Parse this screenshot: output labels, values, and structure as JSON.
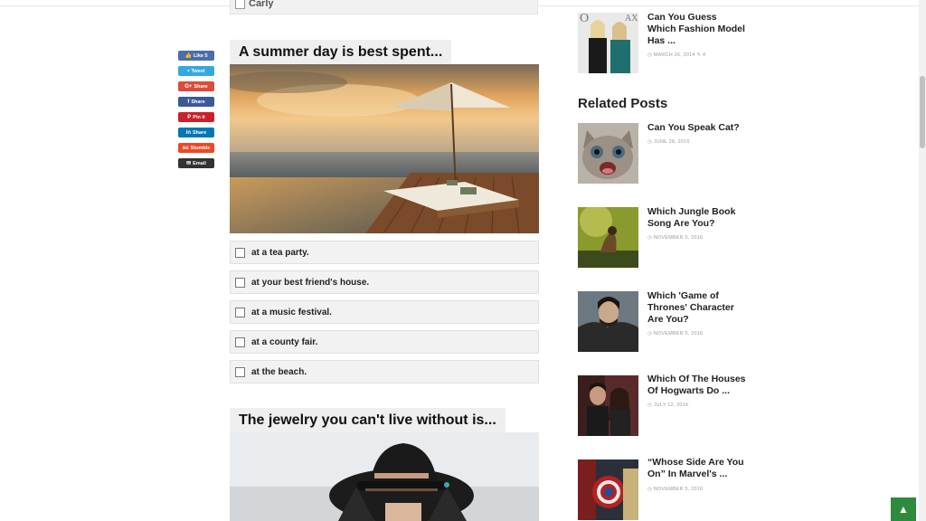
{
  "prev_answer": {
    "label": "Carly"
  },
  "share_buttons": [
    {
      "label": "Like 5",
      "icon": "thumbs-up-icon",
      "glyph": "👍",
      "color": "#4a6ea8"
    },
    {
      "label": "Tweet",
      "icon": "twitter-icon",
      "glyph": "•",
      "color": "#35a8e0"
    },
    {
      "label": "Share",
      "icon": "google-plus-icon",
      "glyph": "G+",
      "color": "#dd4b39"
    },
    {
      "label": "Share",
      "icon": "facebook-icon",
      "glyph": "f",
      "color": "#3b5998"
    },
    {
      "label": "Pin it",
      "icon": "pinterest-icon",
      "glyph": "P",
      "color": "#cb2027"
    },
    {
      "label": "Share",
      "icon": "linkedin-icon",
      "glyph": "in",
      "color": "#0077b5"
    },
    {
      "label": "Stumble",
      "icon": "stumbleupon-icon",
      "glyph": "su",
      "color": "#eb4924"
    },
    {
      "label": "Email",
      "icon": "email-icon",
      "glyph": "✉",
      "color": "#333333"
    }
  ],
  "question1": {
    "title": "A summer day is best spent...",
    "answers": [
      "at a tea party.",
      "at your best friend's house.",
      "at a music festival.",
      "at a county fair.",
      "at the beach."
    ]
  },
  "question2": {
    "title": "The jewelry you can't live without is..."
  },
  "sidebar": {
    "top_post": {
      "title": "Can You Guess Which Fashion Model Has ...",
      "date": "MARCH 26, 2014",
      "comments": "4"
    },
    "related_heading": "Related Posts",
    "related": [
      {
        "title": "Can You Speak Cat?",
        "date": "JUNE 28, 2016"
      },
      {
        "title": "Which Jungle Book Song Are You?",
        "date": "NOVEMBER 5, 2016"
      },
      {
        "title": "Which 'Game of Thrones' Character Are You?",
        "date": "NOVEMBER 5, 2016"
      },
      {
        "title": "Which Of The Houses Of Hogwarts Do ...",
        "date": "JULY 12, 2016"
      },
      {
        "title": "“Whose Side Are You On” In Marvel's ...",
        "date": "NOVEMBER 5, 2016"
      }
    ]
  },
  "back_to_top": {
    "icon": "chevron-up-icon",
    "glyph": "▲"
  }
}
